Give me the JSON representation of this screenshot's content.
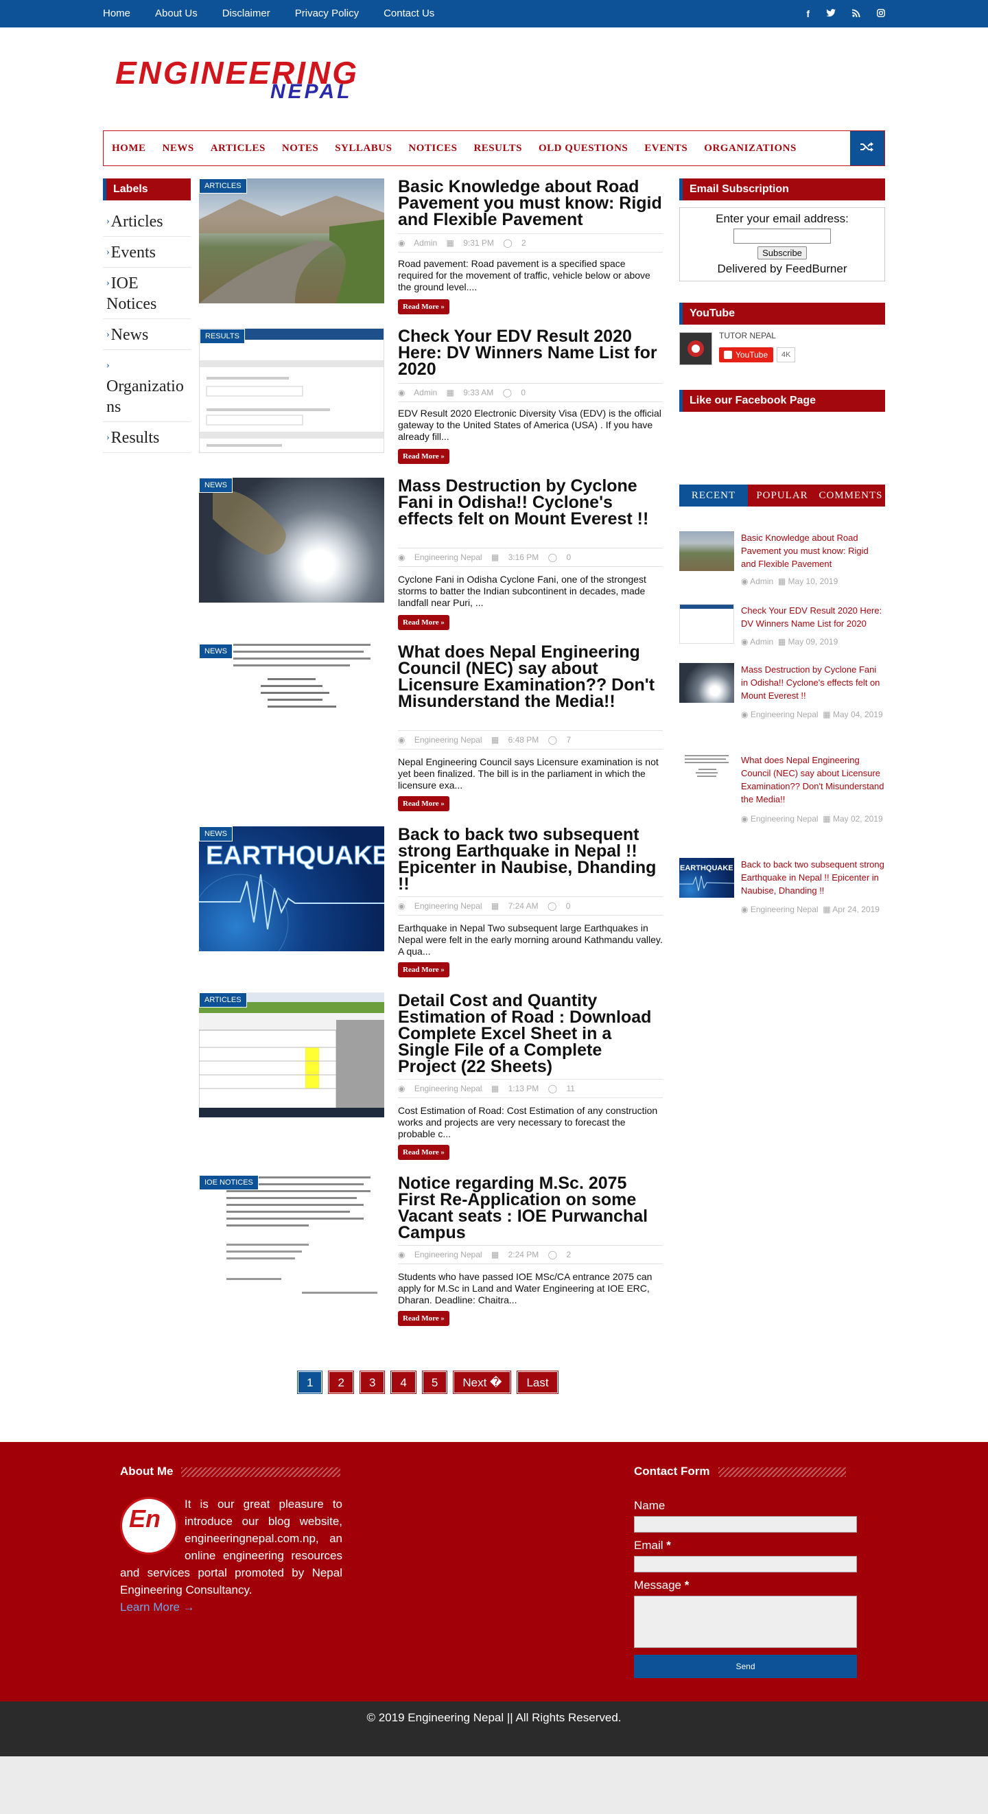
{
  "topnav": [
    "Home",
    "About Us",
    "Disclaimer",
    "Privacy Policy",
    "Contact Us"
  ],
  "social_icons": [
    "facebook-icon",
    "twitter-icon",
    "rss-icon",
    "instagram-icon"
  ],
  "logo": {
    "main": "ENGINEERING",
    "sub": "NEPAL"
  },
  "mainnav": [
    "HOME",
    "NEWS",
    "ARTICLES",
    "NOTES",
    "SYLLABUS",
    "NOTICES",
    "RESULTS",
    "OLD QUESTIONS",
    "EVENTS",
    "ORGANIZATIONS"
  ],
  "labels": {
    "title": "Labels",
    "items": [
      "Articles",
      "Events",
      "IOE Notices",
      "News",
      "Organizations",
      "Results"
    ]
  },
  "posts": [
    {
      "badge": "ARTICLES",
      "title": "Basic Knowledge about Road Pavement you must know: Rigid and Flexible Pavement",
      "author": "Admin",
      "time": "9:31 PM",
      "comments": "2",
      "excerpt": "Road pavement: Road pavement is a specified space required for the movement of traffic, vehicle below or above the ground  level....",
      "readmore": "Read More »"
    },
    {
      "badge": "RESULTS",
      "title": "Check Your EDV Result 2020 Here: DV Winners Name List for 2020",
      "author": "Admin",
      "time": "9:33 AM",
      "comments": "0",
      "excerpt": "EDV Result 2020 Electronic Diversity Visa (EDV) is the official gateway to the  United States of America (USA) . If you have already fill...",
      "readmore": "Read More »"
    },
    {
      "badge": "NEWS",
      "title": "Mass Destruction by Cyclone Fani in Odisha!! Cyclone's effects felt on Mount Everest !!",
      "author": "Engineering Nepal",
      "time": "3:16 PM",
      "comments": "0",
      "excerpt": "Cyclone Fani in Odisha Cyclone Fani, one of the strongest storms to batter the Indian subcontinent in decades, made landfall near Puri, ...",
      "readmore": "Read More »"
    },
    {
      "badge": "NEWS",
      "title": "What does Nepal Engineering Council (NEC) say about Licensure Examination?? Don't Misunderstand the Media!!",
      "author": "Engineering Nepal",
      "time": "6:48 PM",
      "comments": "7",
      "excerpt": "Nepal Engineering Council says Licensure examination is not yet been finalized. The bill is in the parliament in which the licensure exa...",
      "readmore": "Read More »"
    },
    {
      "badge": "NEWS",
      "title": "Back to back two subsequent strong Earthquake in Nepal !! Epicenter in Naubise, Dhanding !!",
      "author": "Engineering Nepal",
      "time": "7:24 AM",
      "comments": "0",
      "excerpt": "Earthquake in Nepal Two subsequent large Earthquakes in Nepal were felt in the early morning around Kathmandu valley. A qua...",
      "readmore": "Read More »"
    },
    {
      "badge": "ARTICLES",
      "title": "Detail Cost and Quantity Estimation of Road : Download Complete Excel Sheet in a Single File of a Complete Project (22 Sheets)",
      "author": "Engineering Nepal",
      "time": "1:13 PM",
      "comments": "11",
      "excerpt": "Cost Estimation of Road: Cost Estimation of any construction works and projects are very necessary to forecast the probable c...",
      "readmore": "Read More »"
    },
    {
      "badge": "IOE NOTICES",
      "title": "Notice regarding M.Sc. 2075 First Re-Application on some Vacant seats : IOE Purwanchal Campus",
      "author": "Engineering Nepal",
      "time": "2:24 PM",
      "comments": "2",
      "excerpt": "Students who have passed IOE MSc/CA entrance 2075 can apply for M.Sc in Land and Water Engineering at IOE ERC, Dharan. Deadline: Chaitra...",
      "readmore": "Read More »"
    }
  ],
  "thumb_texts": {
    "earthquake": "EARTHQUAKE"
  },
  "pagination": [
    "1",
    "2",
    "3",
    "4",
    "5",
    "Next �",
    "Last"
  ],
  "sidebar": {
    "email": {
      "title": "Email Subscription",
      "label": "Enter your email address:",
      "button": "Subscribe",
      "delivered": "Delivered by ",
      "feedburner": "FeedBurner"
    },
    "youtube": {
      "title": "YouTube",
      "channel": "TUTOR NEPAL",
      "button": "YouTube",
      "count": "4K"
    },
    "facebook": {
      "title": "Like our Facebook Page"
    },
    "tabs": [
      "RECENT",
      "POPULAR",
      "COMMENTS"
    ],
    "recent": [
      {
        "title": "Basic Knowledge about Road Pavement you must know: Rigid and Flexible Pavement",
        "author": "Admin",
        "date": "May 10, 2019"
      },
      {
        "title": "Check Your EDV Result 2020 Here: DV Winners Name List for 2020",
        "author": "Admin",
        "date": "May 09, 2019"
      },
      {
        "title": "Mass Destruction by Cyclone Fani in Odisha!! Cyclone's effects felt on Mount Everest !!",
        "author": "Engineering Nepal",
        "date": "May 04, 2019"
      },
      {
        "title": "What does Nepal Engineering Council (NEC) say about Licensure Examination?? Don't Misunderstand the Media!!",
        "author": "Engineering Nepal",
        "date": "May 02, 2019"
      },
      {
        "title": "Back to back two subsequent strong Earthquake in Nepal !! Epicenter in Naubise, Dhanding !!",
        "author": "Engineering Nepal",
        "date": "Apr 24, 2019"
      }
    ]
  },
  "footer": {
    "about_title": "About Me",
    "about_text": "It is our great pleasure to introduce our blog website, engineeringnepal.com.np, an online engineering resources and services portal promoted by Nepal Engineering Consultancy.",
    "learn_more": "Learn More →",
    "avatar_text": "En",
    "contact_title": "Contact Form",
    "name_label": "Name",
    "email_label": "Email",
    "message_label": "Message",
    "required_mark": "*",
    "send": "Send",
    "copyright": "© 2019 Engineering Nepal || All Rights Reserved."
  },
  "colors": {
    "brand_red": "#a4080f",
    "brand_blue": "#0d5296",
    "footer_red": "#a20009",
    "footer_dark": "#2b2b2b"
  }
}
